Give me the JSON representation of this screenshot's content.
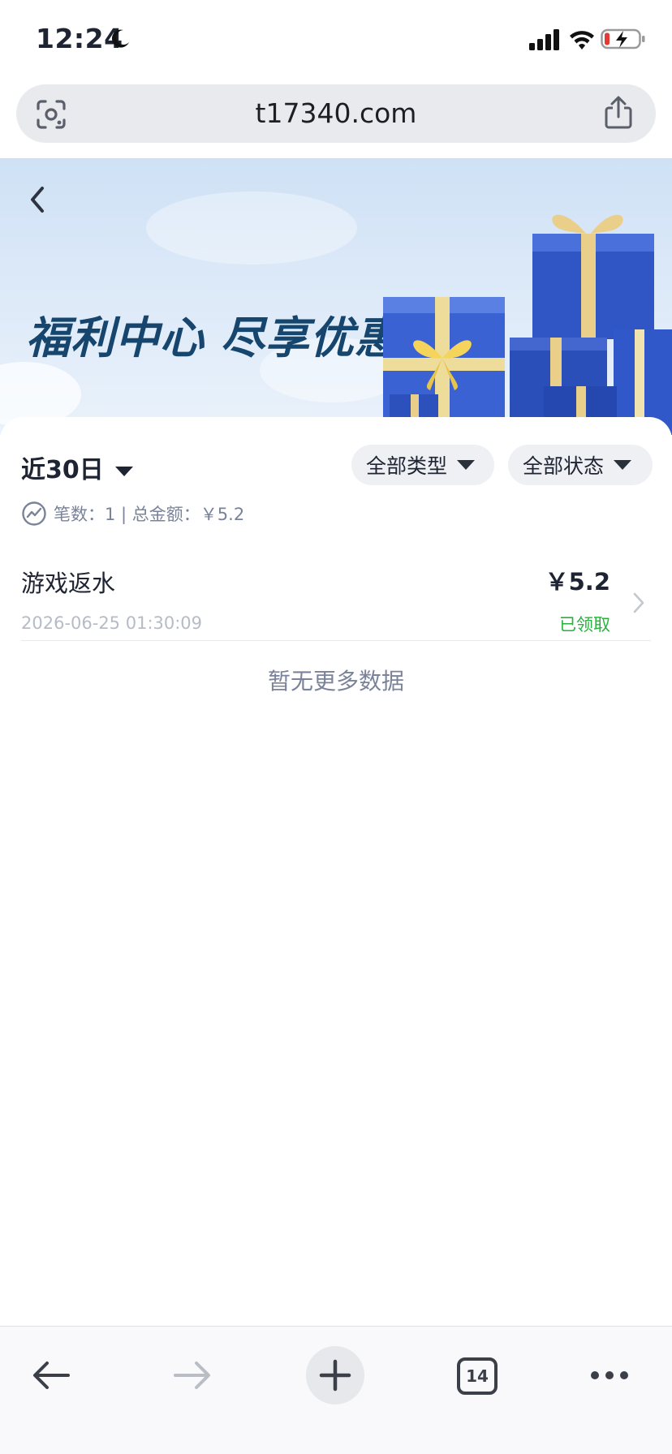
{
  "status_bar": {
    "time": "12:24"
  },
  "browser": {
    "url": "t17340.com"
  },
  "banner": {
    "title": "福利中心 尽享优惠"
  },
  "filters": {
    "period": "近30日",
    "type": "全部类型",
    "status": "全部状态"
  },
  "summary": {
    "text": "笔数：1 | 总金额：￥5.2"
  },
  "records": [
    {
      "title": "游戏返水",
      "time": "2026-06-25 01:30:09",
      "amount": "￥5.2",
      "status": "已领取"
    }
  ],
  "no_more": "暂无更多数据",
  "toolbar": {
    "tab_count": "14"
  },
  "colors": {
    "banner_title": "#16466d",
    "status_claimed": "#25b33a",
    "muted_text": "#7a8399"
  }
}
